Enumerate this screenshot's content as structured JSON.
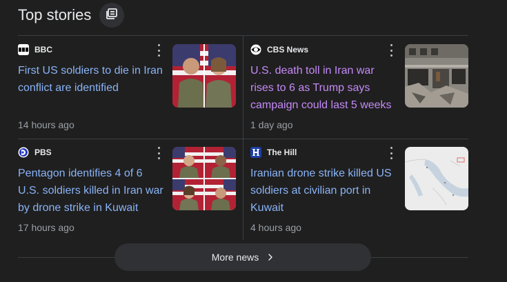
{
  "header": {
    "title": "Top stories",
    "icon": "feed-icon"
  },
  "stories": [
    {
      "source": "BBC",
      "source_icon": "bbc-logo-icon",
      "headline": "First US soldiers to die in Iran conflict are identified",
      "time": "14 hours ago",
      "thumbnail": "soldiers-portrait-photo",
      "visited": false
    },
    {
      "source": "CBS News",
      "source_icon": "cbs-eye-logo-icon",
      "headline": "U.S. death toll in Iran war rises to 6 as Trump says campaign could last 5 weeks",
      "time": "1 day ago",
      "thumbnail": "damaged-building-photo",
      "visited": true
    },
    {
      "source": "PBS",
      "source_icon": "pbs-logo-icon",
      "headline": "Pentagon identifies 4 of 6 U.S. soldiers killed in Iran war by drone strike in Kuwait",
      "time": "17 hours ago",
      "thumbnail": "four-soldiers-portraits-photo",
      "visited": false
    },
    {
      "source": "The Hill",
      "source_icon": "the-hill-logo-icon",
      "headline": "Iranian drone strike killed US soldiers at civilian port in Kuwait",
      "time": "4 hours ago",
      "thumbnail": "persian-gulf-map",
      "visited": false
    }
  ],
  "more_news": {
    "label": "More news",
    "icon": "chevron-right-icon"
  },
  "colors": {
    "background": "#1f1f1f",
    "link": "#8ab4f8",
    "visited_link": "#c58af9",
    "text_primary": "#e8eaed",
    "text_secondary": "#9aa0a6",
    "divider": "#3c4043",
    "button_bg": "#303134"
  }
}
